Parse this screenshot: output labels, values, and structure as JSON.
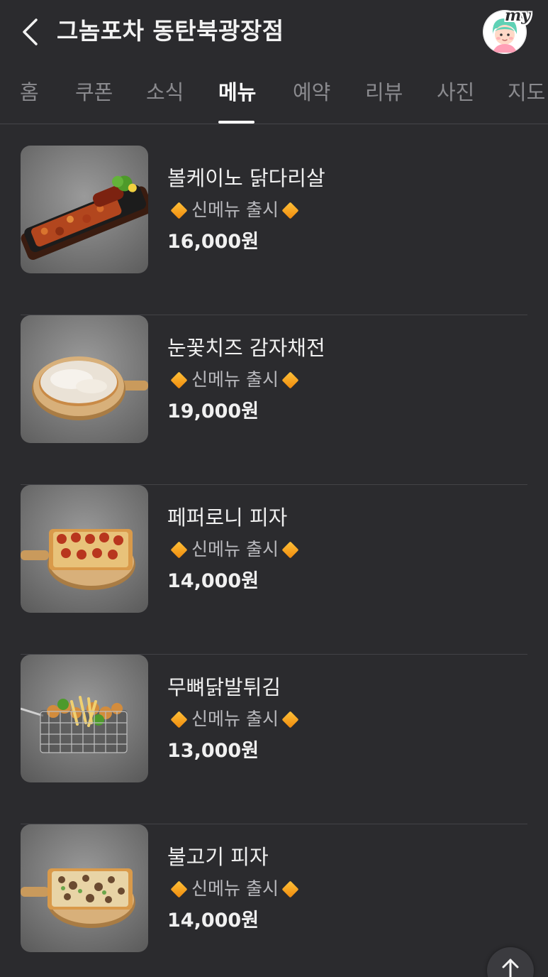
{
  "header": {
    "title": "그놈포차 동탄북광장점",
    "back_icon": "chevron-left-icon",
    "avatar_badge": "my",
    "avatar_icon": "profile-avatar-icon"
  },
  "tabs": [
    {
      "label": "홈"
    },
    {
      "label": "쿠폰"
    },
    {
      "label": "소식"
    },
    {
      "label": "메뉴",
      "active": true
    },
    {
      "label": "예약"
    },
    {
      "label": "리뷰"
    },
    {
      "label": "사진"
    },
    {
      "label": "지도"
    }
  ],
  "menu": [
    {
      "name": "볼케이노 닭다리살",
      "desc": "신메뉴 출시",
      "price": "16,000원",
      "image": "sizzling-chicken-platter"
    },
    {
      "name": "눈꽃치즈 감자채전",
      "desc": "신메뉴 출시",
      "price": "19,000원",
      "image": "cheese-potato-pancake"
    },
    {
      "name": "페퍼로니 피자",
      "desc": "신메뉴 출시",
      "price": "14,000원",
      "image": "pepperoni-pizza"
    },
    {
      "name": "무뼈닭발튀김",
      "desc": "신메뉴 출시",
      "price": "13,000원",
      "image": "fried-chicken-feet-basket"
    },
    {
      "name": "불고기 피자",
      "desc": "신메뉴 출시",
      "price": "14,000원",
      "image": "bulgogi-pizza"
    }
  ],
  "colors": {
    "background": "#2b2b2e",
    "divider": "#434347",
    "accent_diamond": "#f5a020",
    "inactive_tab": "#8a8a8e"
  },
  "scroll_top_icon": "arrow-up-icon"
}
